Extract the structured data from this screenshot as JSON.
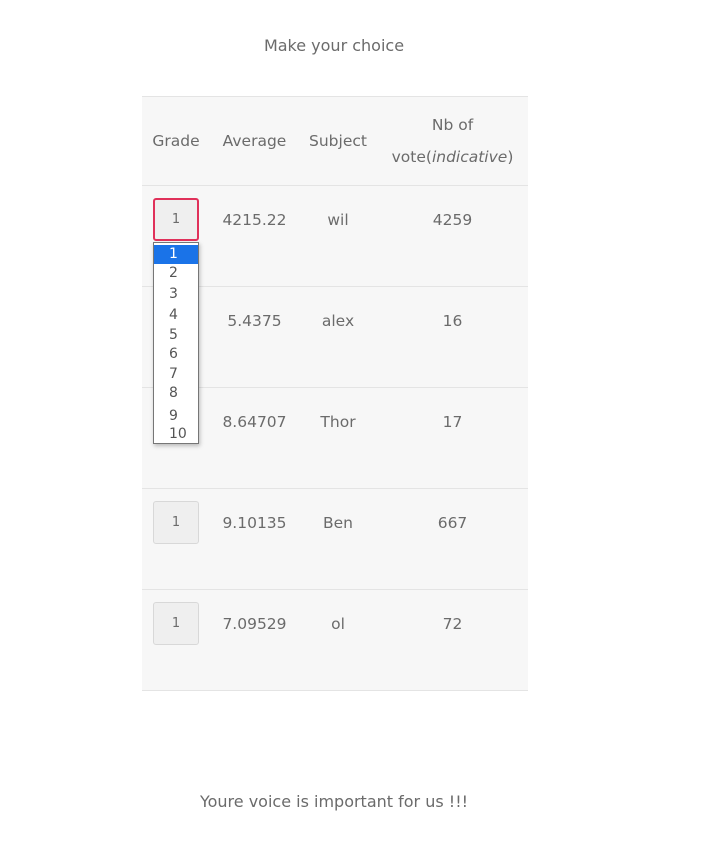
{
  "heading": "Make your choice",
  "table": {
    "headers": {
      "grade": "Grade",
      "average": "Average",
      "subject": "Subject",
      "votes_line1": "Nb of",
      "votes_line2_prefix": "vote(",
      "votes_line2_italic": "indicative",
      "votes_line2_suffix": ")"
    },
    "rows": [
      {
        "grade": "1",
        "average": "4215.22",
        "subject": "wil",
        "votes": "4259"
      },
      {
        "grade": "1",
        "average": "5.4375",
        "subject": "alex",
        "votes": "16"
      },
      {
        "grade": "1",
        "average": "8.64707",
        "subject": "Thor",
        "votes": "17"
      },
      {
        "grade": "1",
        "average": "9.10135",
        "subject": "Ben",
        "votes": "667"
      },
      {
        "grade": "1",
        "average": "7.09529",
        "subject": "ol",
        "votes": "72"
      }
    ]
  },
  "dropdown": {
    "selected": "1",
    "options": [
      "1",
      "2",
      "3",
      "4",
      "5",
      "6",
      "7",
      "8",
      "9",
      "10"
    ]
  },
  "footer": "Youre voice is important for us !!!",
  "colors": {
    "focus_border": "#e0315a",
    "selected_option": "#1a73e8",
    "table_bg": "#f7f7f7"
  }
}
